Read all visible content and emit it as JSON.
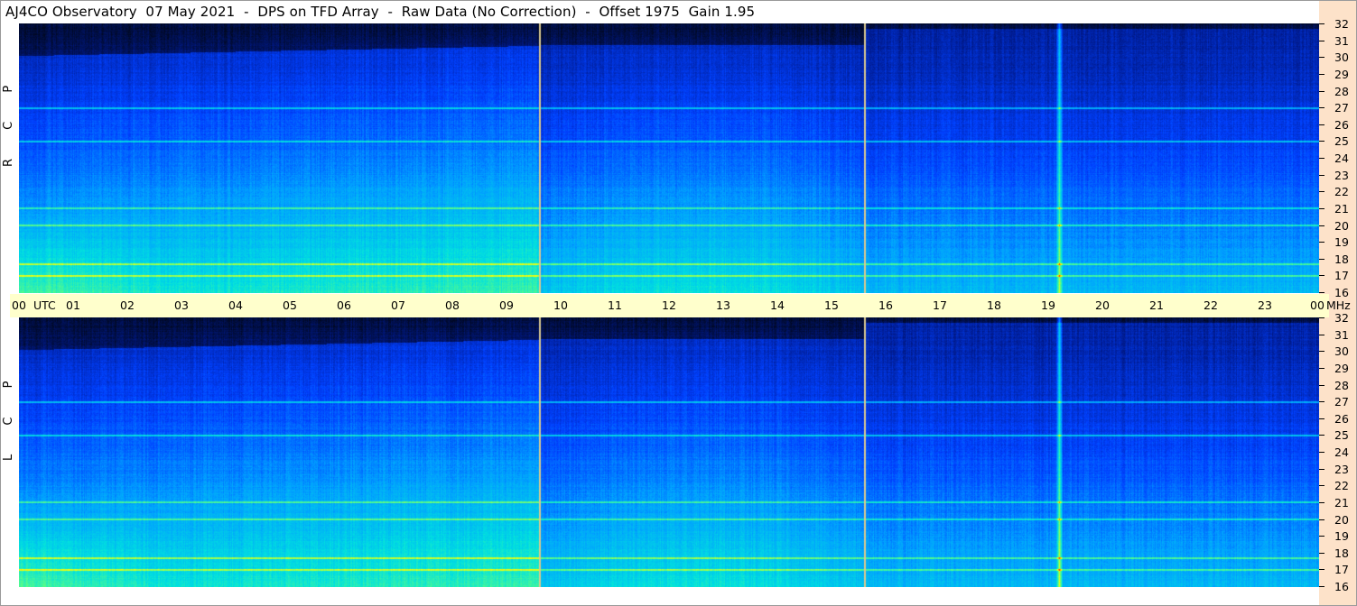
{
  "title": "AJ4CO Observatory  07 May 2021  -  DPS on TFD Array  -  Raw Data (No Correction)  -  Offset 1975  Gain 1.95",
  "panels": {
    "top": {
      "label": "R C P"
    },
    "bottom": {
      "label": "L C P"
    }
  },
  "time_axis": {
    "start_label": "00",
    "utc_label": "UTC",
    "hour_labels": [
      "01",
      "02",
      "03",
      "04",
      "05",
      "06",
      "07",
      "08",
      "09",
      "10",
      "11",
      "12",
      "13",
      "14",
      "15",
      "16",
      "17",
      "18",
      "19",
      "20",
      "21",
      "22",
      "23"
    ],
    "end_label": "00",
    "unit_label": "MHz"
  },
  "freq_axis": {
    "labels": [
      "32",
      "31",
      "30",
      "29",
      "28",
      "27",
      "26",
      "25",
      "24",
      "23",
      "22",
      "21",
      "20",
      "19",
      "18",
      "17",
      "16"
    ]
  },
  "chart_data": {
    "type": "heatmap",
    "title": "AJ4CO Observatory  07 May 2021  -  DPS on TFD Array  -  Raw Data (No Correction)  -  Offset 1975  Gain 1.95",
    "xlabel": "UTC",
    "ylabel": "MHz",
    "x_range_hours_utc": [
      0,
      24
    ],
    "y_range_mhz": [
      16,
      32
    ],
    "x_ticks": [
      "00",
      "01",
      "02",
      "03",
      "04",
      "05",
      "06",
      "07",
      "08",
      "09",
      "10",
      "11",
      "12",
      "13",
      "14",
      "15",
      "16",
      "17",
      "18",
      "19",
      "20",
      "21",
      "22",
      "23",
      "00"
    ],
    "y_ticks": [
      32,
      31,
      30,
      29,
      28,
      27,
      26,
      25,
      24,
      23,
      22,
      21,
      20,
      19,
      18,
      17,
      16
    ],
    "panels": [
      "R C P",
      "L C P"
    ],
    "colormap": [
      "#000820",
      "#001a8c",
      "#0040ff",
      "#00a0ff",
      "#00e0e0",
      "#60ff80",
      "#ffff00",
      "#ff4000"
    ],
    "marker_lines_utc_hours": [
      9.6,
      15.6
    ],
    "marker_line_color": "#d8c890",
    "strong_vertical_band_utc_hours": 19.2,
    "persistent_interference_mhz": [
      17.0,
      17.7,
      20.0,
      21.0,
      25.0,
      27.0
    ]
  }
}
